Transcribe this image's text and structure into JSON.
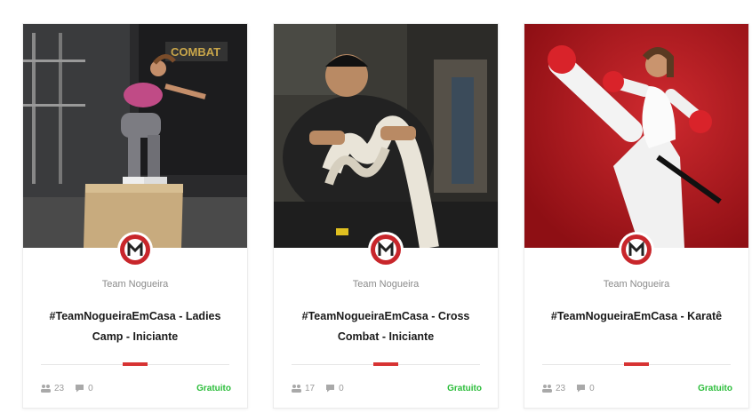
{
  "courses": [
    {
      "author": "Team Nogueira",
      "title": "#TeamNogueiraEmCasa - Ladies Camp - Iniciante",
      "students": "23",
      "comments": "0",
      "price": "Gratuito",
      "photo_icon": "box-jump-photo"
    },
    {
      "author": "Team Nogueira",
      "title": "#TeamNogueiraEmCasa - Cross Combat - Iniciante",
      "students": "17",
      "comments": "0",
      "price": "Gratuito",
      "photo_icon": "battle-rope-photo"
    },
    {
      "author": "Team Nogueira",
      "title": "#TeamNogueiraEmCasa - Karatê",
      "students": "23",
      "comments": "0",
      "price": "Gratuito",
      "photo_icon": "karate-kick-photo"
    }
  ],
  "colors": {
    "accent": "#d73333",
    "price": "#2bbd3a",
    "brand": "#c8262b"
  }
}
